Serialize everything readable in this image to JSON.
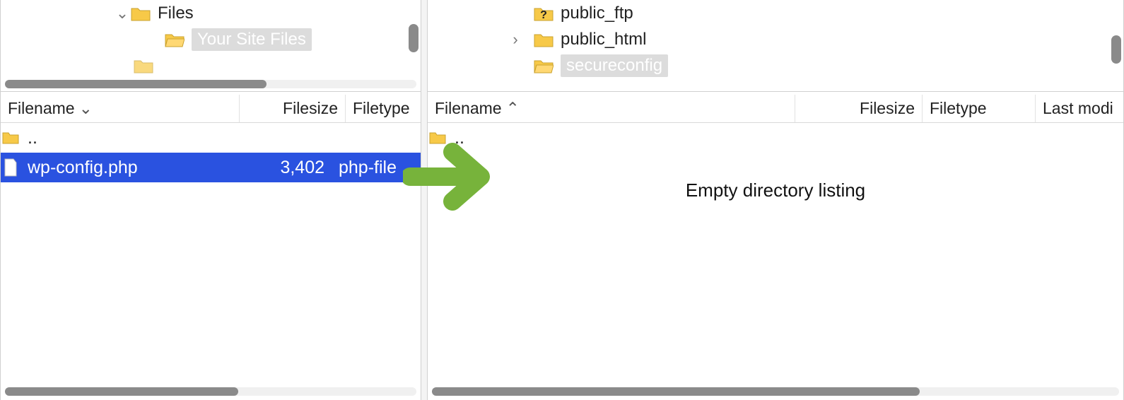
{
  "left": {
    "tree": [
      {
        "label": "Files",
        "indent": 160,
        "expander": "v",
        "selected": false,
        "icon": "folder"
      },
      {
        "label": "Your Site Files",
        "indent": 230,
        "expander": "",
        "selected": true,
        "icon": "folder-open"
      }
    ],
    "headers": {
      "filename": "Filename",
      "filesize": "Filesize",
      "filetype": "Filetype"
    },
    "sort": "desc",
    "rows": [
      {
        "name": "..",
        "size": "",
        "type": "",
        "icon": "folder",
        "selected": false
      },
      {
        "name": "wp-config.php",
        "size": "3,402",
        "type": "php-file",
        "icon": "file",
        "selected": true
      }
    ]
  },
  "right": {
    "tree": [
      {
        "label": "public_ftp",
        "indent": 150,
        "expander": "",
        "selected": false,
        "icon": "folder-question"
      },
      {
        "label": "public_html",
        "indent": 150,
        "expander": ">",
        "selected": false,
        "icon": "folder"
      },
      {
        "label": "secureconfig",
        "indent": 150,
        "expander": "",
        "selected": true,
        "icon": "folder-open"
      }
    ],
    "headers": {
      "filename": "Filename",
      "filesize": "Filesize",
      "filetype": "Filetype",
      "lastmod": "Last modi"
    },
    "sort": "asc",
    "rows": [
      {
        "name": "..",
        "size": "",
        "type": "",
        "icon": "folder",
        "selected": false
      }
    ],
    "empty_message": "Empty directory listing"
  },
  "accent_selection": "#2a52e0",
  "arrow_color": "#77b33b"
}
